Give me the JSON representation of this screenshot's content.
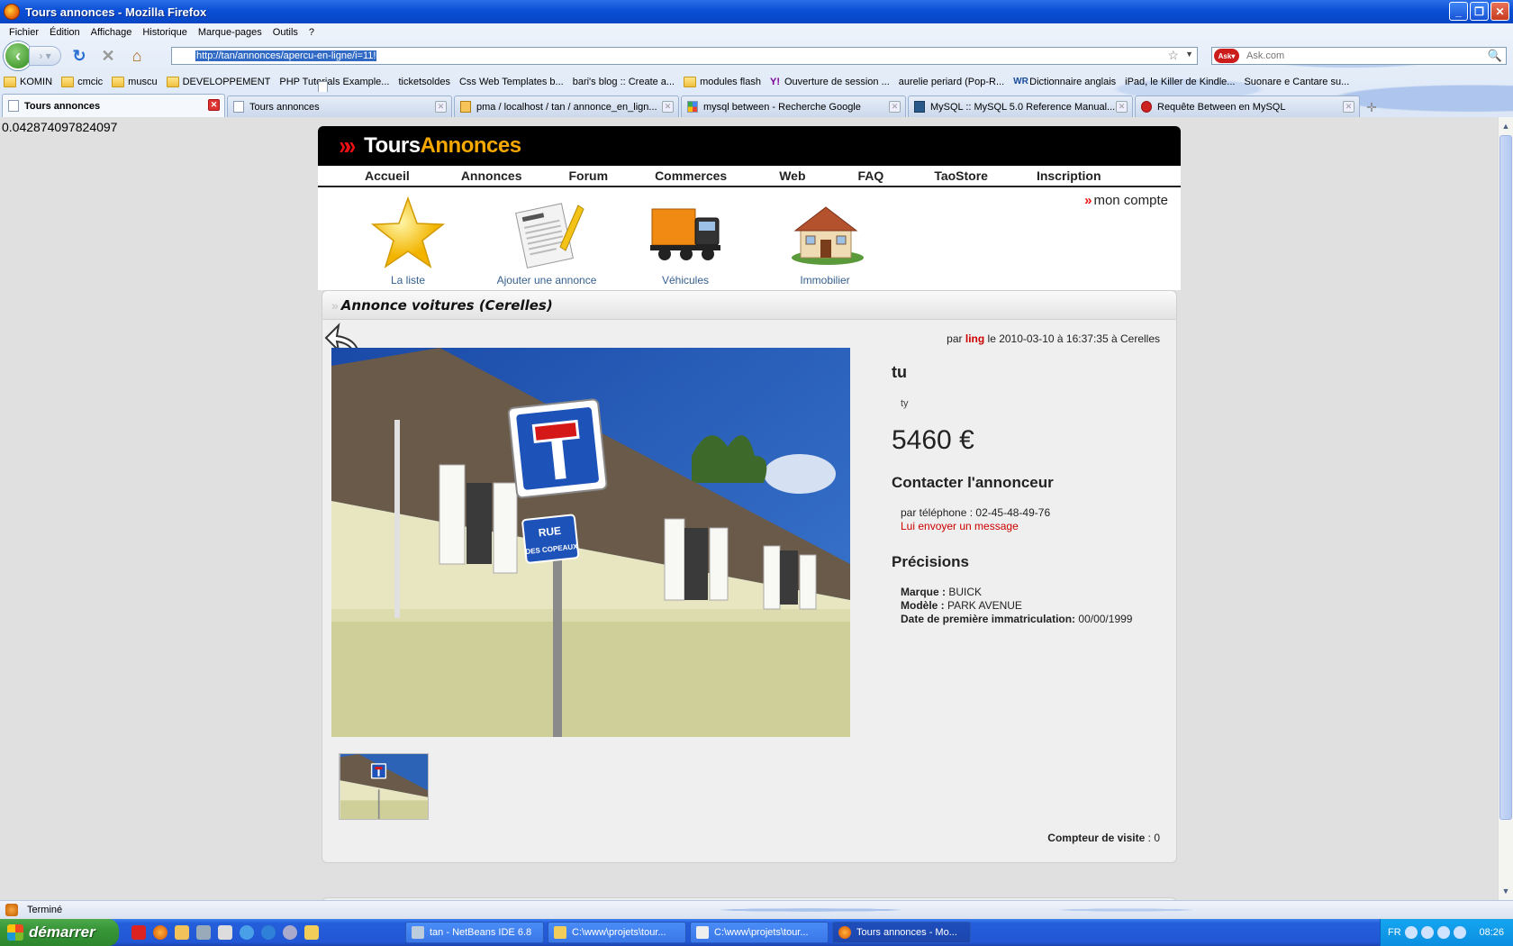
{
  "window": {
    "title": "Tours annonces - Mozilla Firefox"
  },
  "menu": [
    "Fichier",
    "Édition",
    "Affichage",
    "Historique",
    "Marque-pages",
    "Outils",
    "?"
  ],
  "url": "http://tan/annonces/apercu-en-ligne/i=11!",
  "search_placeholder": "Ask.com",
  "bookmarks": [
    {
      "label": "KOMIN",
      "type": "folder"
    },
    {
      "label": "cmcic",
      "type": "folder"
    },
    {
      "label": "muscu",
      "type": "folder"
    },
    {
      "label": "DEVELOPPEMENT",
      "type": "folder"
    },
    {
      "label": "PHP Tutorials Example...",
      "type": "page"
    },
    {
      "label": "ticketsoldes",
      "type": "page"
    },
    {
      "label": "Css Web Templates b...",
      "type": "page"
    },
    {
      "label": "bari's blog :: Create a...",
      "type": "page"
    },
    {
      "label": "modules flash",
      "type": "folder"
    },
    {
      "label": "Ouverture de session ...",
      "type": "yahoo"
    },
    {
      "label": "aurelie periard (Pop-R...",
      "type": "page"
    },
    {
      "label": "Dictionnaire anglais",
      "type": "wr"
    },
    {
      "label": "iPad, le Killer de Kindle...",
      "type": "page"
    },
    {
      "label": "Suonare e Cantare su...",
      "type": "page"
    }
  ],
  "tabs": [
    {
      "label": "Tours annonces",
      "active": true
    },
    {
      "label": "Tours annonces",
      "active": false
    },
    {
      "label": "pma / localhost / tan / annonce_en_lign...",
      "active": false
    },
    {
      "label": "mysql between - Recherche Google",
      "active": false
    },
    {
      "label": "MySQL :: MySQL 5.0 Reference Manual...",
      "active": false
    },
    {
      "label": "Requête Between en MySQL",
      "active": false
    }
  ],
  "debug_value": "0.042874097824097",
  "site": {
    "logo_part1": "Tours",
    "logo_part2": "Annonces",
    "nav": [
      "Accueil",
      "Annonces",
      "Forum",
      "Commerces",
      "Web",
      "FAQ",
      "TaoStore",
      "Inscription"
    ],
    "mon_compte": "mon compte",
    "categories": [
      {
        "label": "La liste",
        "icon": "star-icon"
      },
      {
        "label": "Ajouter une annonce",
        "icon": "blog-pen-icon"
      },
      {
        "label": "Véhicules",
        "icon": "truck-icon"
      },
      {
        "label": "Immobilier",
        "icon": "house-icon"
      }
    ]
  },
  "ad": {
    "heading": "Annonce voitures (Cerelles)",
    "meta_prefix": "par",
    "meta_user": "ling",
    "meta_suffix": "le 2010-03-10 à 16:37:35 à Cerelles",
    "title": "tu",
    "description": "ty",
    "price": "5460 €",
    "contact_heading": "Contacter l'annonceur",
    "phone_label": "par téléphone : 02-45-48-49-76",
    "message_link": "Lui envoyer un message",
    "details_heading": "Précisions",
    "details": [
      {
        "label": "Marque :",
        "value": "BUICK"
      },
      {
        "label": "Modèle :",
        "value": "PARK AVENUE"
      },
      {
        "label": "Date de première immatriculation:",
        "value": "00/00/1999"
      }
    ],
    "counter_label": "Compteur de visite",
    "counter_value": ": 0",
    "sign_text_1": "RUE",
    "sign_text_2": "DES COPEAUX"
  },
  "status": "Terminé",
  "taskbar": {
    "start": "démarrer",
    "tasks": [
      {
        "label": "tan - NetBeans IDE 6.8",
        "active": false
      },
      {
        "label": "C:\\www\\projets\\tour...",
        "active": false
      },
      {
        "label": "C:\\www\\projets\\tour...",
        "active": false
      },
      {
        "label": "Tours annonces - Mo...",
        "active": true
      }
    ],
    "lang": "FR",
    "clock": "08:26"
  },
  "colors": {
    "accent_red": "#cc0000",
    "logo_orange": "#f4a800",
    "xp_blue": "#245edb"
  }
}
